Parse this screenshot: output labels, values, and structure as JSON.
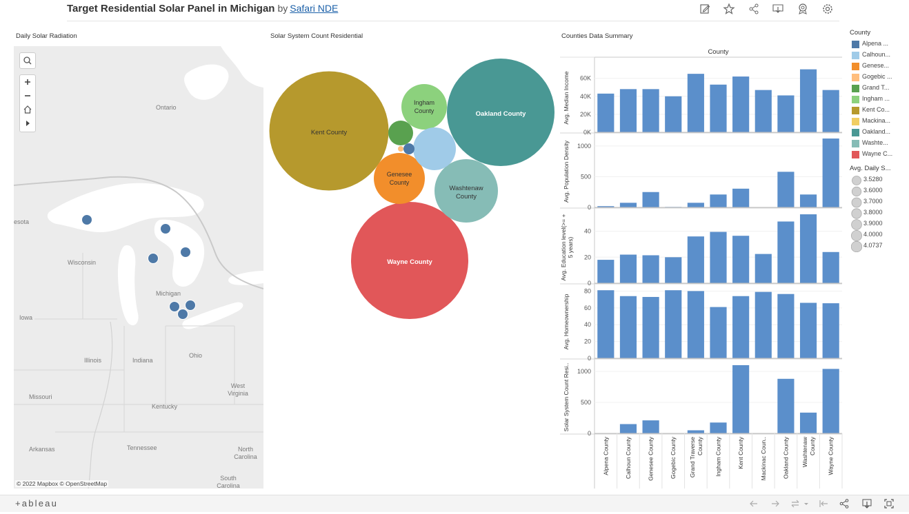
{
  "header": {
    "title": "Target Residential Solar Panel in Michigan",
    "by": "by",
    "author": "Safari NDE",
    "icons": [
      "edit-icon",
      "star-icon",
      "share-icon",
      "download-icon",
      "badge-icon",
      "settings-icon"
    ]
  },
  "worksheets": {
    "map_title": "Daily Solar Radiation",
    "bubble_title": "Solar System Count Residential",
    "summary_title": "Counties Data Summary"
  },
  "map": {
    "labels": [
      "Ontario",
      "esota",
      "Wisconsin",
      "Michigan",
      "Iowa",
      "Illinois",
      "Indiana",
      "Ohio",
      "West Virginia",
      "Missouri",
      "Kentucky",
      "Arkansas",
      "Tennessee",
      "North Carolina",
      "South Carolina"
    ],
    "attribution": "© 2022 Mapbox  © OpenStreetMap",
    "point_color": "#4e79a7"
  },
  "bubbles": [
    {
      "label": "Kent County",
      "value": 1050,
      "color": "#b6992d",
      "text_color": "#333333"
    },
    {
      "label": "Oakland County",
      "value": 880,
      "color": "#499894",
      "text_color": "#ffffff"
    },
    {
      "label": "Wayne County",
      "value": 1020,
      "color": "#e15759",
      "text_color": "#ffffff"
    },
    {
      "label": "Washtenaw County",
      "value": 300,
      "color": "#86bcb6",
      "text_color": "#333333"
    },
    {
      "label": "Genesee County",
      "value": 190,
      "color": "#f28e2b",
      "text_color": "#333333"
    },
    {
      "label": "Ingham County",
      "value": 150,
      "color": "#8cd17d",
      "text_color": "#333333"
    },
    {
      "label": "",
      "value": 135,
      "color": "#a0cbe8",
      "text_color": "#333333"
    },
    {
      "label": "",
      "value": 45,
      "color": "#59a14f",
      "text_color": "#333333"
    },
    {
      "label": "",
      "value": 10,
      "color": "#4e79a7",
      "text_color": "#333333"
    },
    {
      "label": "",
      "value": 3,
      "color": "#ffbe7d",
      "text_color": "#333333"
    }
  ],
  "legend": {
    "county_title": "County",
    "counties": [
      {
        "label": "Alpena ...",
        "color": "#4e79a7"
      },
      {
        "label": "Calhoun...",
        "color": "#a0cbe8"
      },
      {
        "label": "Genese...",
        "color": "#f28e2b"
      },
      {
        "label": "Gogebic ...",
        "color": "#ffbe7d"
      },
      {
        "label": "Grand T...",
        "color": "#59a14f"
      },
      {
        "label": "Ingham ...",
        "color": "#8cd17d"
      },
      {
        "label": "Kent Co...",
        "color": "#b6992d"
      },
      {
        "label": "Mackina...",
        "color": "#f1ce63"
      },
      {
        "label": "Oakland...",
        "color": "#499894"
      },
      {
        "label": "Washte...",
        "color": "#86bcb6"
      },
      {
        "label": "Wayne C...",
        "color": "#e15759"
      }
    ],
    "size_title": "Avg. Daily S...",
    "sizes": [
      "3.5280",
      "3.6000",
      "3.7000",
      "3.8000",
      "3.9000",
      "4.0000",
      "4.0737"
    ]
  },
  "chart_data": {
    "type": "bar",
    "column_header": "County",
    "categories": [
      "Alpena County",
      "Calhoun County",
      "Genesee County",
      "Gogebic County",
      "Grand Traverse County",
      "Ingham County",
      "Kent County",
      "Mackinac Coun..",
      "Oakland County",
      "Washtenaw County",
      "Wayne County"
    ],
    "bar_color": "#5b8fcb",
    "panels": [
      {
        "ylabel": "Avg. Median Income",
        "ylim": [
          0,
          72000
        ],
        "ticks": [
          {
            "v": 0,
            "t": "0K"
          },
          {
            "v": 20000,
            "t": "20K"
          },
          {
            "v": 40000,
            "t": "40K"
          },
          {
            "v": 60000,
            "t": "60K"
          }
        ],
        "values": [
          43000,
          48000,
          48000,
          40000,
          65000,
          53000,
          62000,
          47000,
          41000,
          70000,
          47000
        ]
      },
      {
        "ylabel": "Avg. Population Density",
        "ylim": [
          0,
          1100
        ],
        "ticks": [
          {
            "v": 0,
            "t": "0"
          },
          {
            "v": 500,
            "t": "500"
          },
          {
            "v": 1000,
            "t": "1000"
          }
        ],
        "values": [
          20,
          75,
          250,
          8,
          75,
          210,
          305,
          0,
          580,
          210,
          1140
        ]
      },
      {
        "ylabel": "Avg. Education level(>= + 5 years)",
        "ylim": [
          0,
          52
        ],
        "ticks": [
          {
            "v": 0,
            "t": "0"
          },
          {
            "v": 20,
            "t": "20"
          },
          {
            "v": 40,
            "t": "40"
          }
        ],
        "values": [
          18,
          22,
          21.5,
          20,
          36,
          39.5,
          36.5,
          22.5,
          47.5,
          57,
          24
        ]
      },
      {
        "ylabel": "Avg. Homeownership",
        "ylim": [
          0,
          82
        ],
        "ticks": [
          {
            "v": 0,
            "t": "0"
          },
          {
            "v": 20,
            "t": "20"
          },
          {
            "v": 40,
            "t": "40"
          },
          {
            "v": 60,
            "t": "60"
          },
          {
            "v": 80,
            "t": "80"
          }
        ],
        "values": [
          81,
          74,
          73,
          81,
          80,
          61,
          74,
          79,
          76.5,
          66,
          65.5
        ]
      },
      {
        "ylabel": "Solar System Count Resi..",
        "ylim": [
          0,
          1100
        ],
        "ticks": [
          {
            "v": 0,
            "t": "0"
          },
          {
            "v": 500,
            "t": "500"
          },
          {
            "v": 1000,
            "t": "1000"
          }
        ],
        "values": [
          5,
          150,
          210,
          0,
          50,
          175,
          1100,
          0,
          880,
          335,
          1040
        ]
      }
    ]
  },
  "footer": {
    "logo": "+ableau",
    "icons": [
      "undo-icon",
      "redo-icon",
      "revert-icon",
      "reset-icon",
      "share-icon",
      "download-icon",
      "fullscreen-icon"
    ]
  }
}
